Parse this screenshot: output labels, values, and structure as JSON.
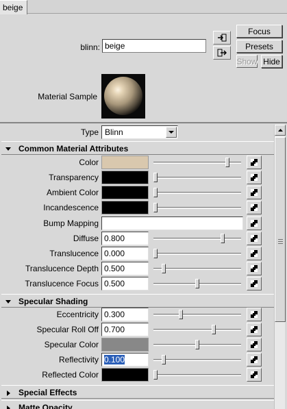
{
  "tab": {
    "label": "beige"
  },
  "header": {
    "node_label": "blinn:",
    "node_value": "beige",
    "focus_label": "Focus",
    "presets_label": "Presets",
    "show_label": "Show",
    "hide_label": "Hide",
    "material_sample_label": "Material Sample",
    "icons": [
      "input-connection-icon",
      "output-connection-icon"
    ]
  },
  "type_row": {
    "label": "Type",
    "value": "Blinn"
  },
  "sections": {
    "common": "Common Material Attributes",
    "specular": "Specular Shading",
    "special": "Special Effects",
    "matte": "Matte Opacity"
  },
  "attributes": {
    "color": {
      "label": "Color",
      "swatch": "#d9c8ae",
      "slider": 0.86
    },
    "transparency": {
      "label": "Transparency",
      "swatch": "#000000",
      "slider": 0.0
    },
    "ambient": {
      "label": "Ambient Color",
      "swatch": "#000000",
      "slider": 0.0
    },
    "incandescence": {
      "label": "Incandescence",
      "swatch": "#000000",
      "slider": 0.0
    },
    "bump": {
      "label": "Bump Mapping"
    },
    "diffuse": {
      "label": "Diffuse",
      "value": "0.800",
      "slider": 0.8
    },
    "translucence": {
      "label": "Translucence",
      "value": "0.000",
      "slider": 0.0
    },
    "translucence_depth": {
      "label": "Translucence Depth",
      "value": "0.500",
      "slider": 0.1
    },
    "translucence_focus": {
      "label": "Translucence Focus",
      "value": "0.500",
      "slider": 0.5
    },
    "eccentricity": {
      "label": "Eccentricity",
      "value": "0.300",
      "slider": 0.3
    },
    "roll_off": {
      "label": "Specular Roll Off",
      "value": "0.700",
      "slider": 0.7
    },
    "spec_color": {
      "label": "Specular Color",
      "swatch": "#888888",
      "slider": 0.5
    },
    "reflectivity": {
      "label": "Reflectivity",
      "value": "0.100",
      "slider": 0.1
    },
    "reflected_color": {
      "label": "Reflected Color",
      "swatch": "#000000",
      "slider": 0.0
    }
  }
}
